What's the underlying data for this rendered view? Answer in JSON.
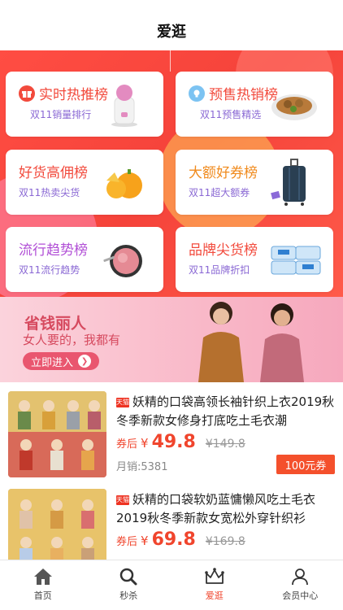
{
  "header": {
    "title": "爱逛"
  },
  "promo_cards": [
    {
      "title": "实时热推榜",
      "subtitle": "双11销量排行",
      "title_color": "#f24a3c",
      "icon": "gift-icon",
      "product": "steamer-image"
    },
    {
      "title": "预售热销榜",
      "subtitle": "双11预售精选",
      "title_color": "#f24a3c",
      "icon": "lightbulb-icon",
      "product": "food-plate-image"
    },
    {
      "title": "好货高佣榜",
      "subtitle": "双11热卖尖货",
      "title_color": "#f24a3c",
      "icon": "",
      "product": "oranges-image"
    },
    {
      "title": "大额好券榜",
      "subtitle": "双11超大额券",
      "title_color": "#f08a1c",
      "icon": "",
      "product": "suitcase-image"
    },
    {
      "title": "流行趋势榜",
      "subtitle": "双11流行趋势",
      "title_color": "#b14fd6",
      "icon": "",
      "product": "blush-compact-image"
    },
    {
      "title": "品牌尖货榜",
      "subtitle": "双11品牌折扣",
      "title_color": "#f24a3c",
      "icon": "",
      "product": "wipes-pack-image"
    }
  ],
  "banner": {
    "headline": "省钱丽人",
    "tagline": "女人要的，我都有",
    "button_label": "立即进入"
  },
  "products": [
    {
      "title": "妖精的口袋高领长袖针织上衣2019秋冬季新款女修身打底吃土毛衣潮",
      "after_label": "券后",
      "currency": "¥",
      "price": "49.8",
      "original_price": "¥149.8",
      "sales": "月销:5381",
      "coupon": "100元券"
    },
    {
      "title": "妖精的口袋软奶蓝慵懒风吃土毛衣2019秋冬季新款女宽松外穿针织衫",
      "after_label": "券后",
      "currency": "¥",
      "price": "69.8",
      "original_price": "¥169.8",
      "sales": "",
      "coupon": ""
    }
  ],
  "tabbar": {
    "items": [
      {
        "label": "首页",
        "icon": "home-icon"
      },
      {
        "label": "秒杀",
        "icon": "search-icon"
      },
      {
        "label": "爱逛",
        "icon": "crown-icon",
        "active": true
      },
      {
        "label": "会员中心",
        "icon": "user-icon"
      }
    ]
  },
  "colors": {
    "accent": "#f0452d",
    "promo_bg": "#f5433a",
    "banner_text": "#d64a5f",
    "active_tab": "#f0452d"
  }
}
